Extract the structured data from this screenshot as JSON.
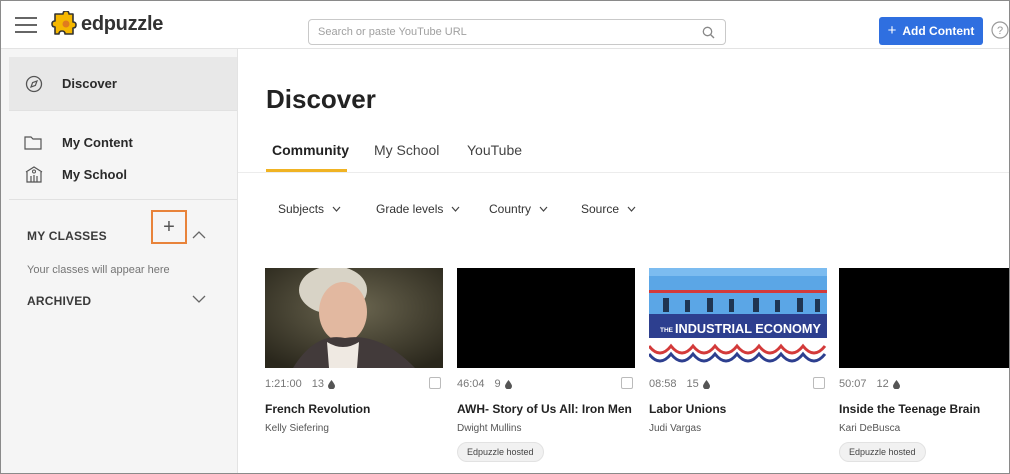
{
  "header": {
    "brand": "edpuzzle",
    "search_placeholder": "Search or paste YouTube URL",
    "add_content_label": "Add Content",
    "add_plus": "+",
    "help_glyph": "?"
  },
  "sidebar": {
    "discover_label": "Discover",
    "my_content_label": "My Content",
    "my_school_label": "My School",
    "my_classes_title": "MY CLASSES",
    "add_class_glyph": "+",
    "classes_hint": "Your classes will appear here",
    "archived_title": "ARCHIVED"
  },
  "main": {
    "page_title": "Discover",
    "tabs": [
      {
        "label": "Community"
      },
      {
        "label": "My School"
      },
      {
        "label": "YouTube"
      }
    ],
    "filters": [
      {
        "label": "Subjects"
      },
      {
        "label": "Grade levels"
      },
      {
        "label": "Country"
      },
      {
        "label": "Source"
      }
    ],
    "cards": [
      {
        "duration": "1:21:00",
        "questions": "13",
        "title": "French Revolution",
        "author": "Kelly Siefering"
      },
      {
        "duration": "46:04",
        "questions": "9",
        "title": "AWH- Story of Us All: Iron Men",
        "author": "Dwight Mullins",
        "badge": "Edpuzzle hosted"
      },
      {
        "duration": "08:58",
        "questions": "15",
        "title": "Labor Unions",
        "author": "Judi Vargas",
        "thumb_caption_small": "THE",
        "thumb_caption": "INDUSTRIAL ECONOMY"
      },
      {
        "duration": "50:07",
        "questions": "12",
        "title": "Inside the Teenage Brain",
        "author": "Kari DeBusca",
        "badge": "Edpuzzle hosted"
      }
    ]
  },
  "colors": {
    "accent_blue": "#2f6fe0",
    "tab_underline": "#f0b323",
    "highlight_box": "#e8833a",
    "logo_yellow": "#f5b700"
  },
  "icons": {
    "menu": "hamburger-icon",
    "logo": "puzzle-logo-icon",
    "search": "search-icon",
    "help": "help-icon",
    "discover": "compass-icon",
    "my_content": "folder-icon",
    "my_school": "school-icon",
    "chevron_up": "chevron-up-icon",
    "chevron_down": "chevron-down-icon",
    "questions": "drop-icon"
  }
}
